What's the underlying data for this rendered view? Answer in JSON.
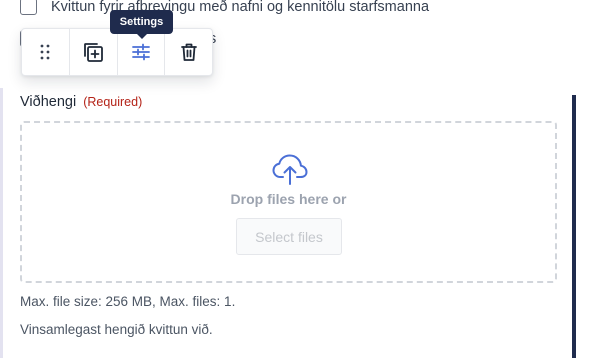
{
  "checkboxes": [
    {
      "label": "Kvittun fyrir afþreyingu með nafni og kennitölu starfsmanna",
      "checked": false
    },
    {
      "label": "s",
      "checked": false
    }
  ],
  "toolbar": {
    "tooltip": "Settings",
    "buttons": [
      {
        "name": "drag-handle",
        "icon": "drag-dots-icon"
      },
      {
        "name": "duplicate",
        "icon": "duplicate-icon"
      },
      {
        "name": "settings",
        "icon": "sliders-icon"
      },
      {
        "name": "delete",
        "icon": "trash-icon"
      }
    ]
  },
  "field": {
    "label": "Viðhengi",
    "required": "(Required)"
  },
  "dropzone": {
    "icon": "cloud-upload-icon",
    "text": "Drop files here or",
    "button_label": "Select files"
  },
  "help": {
    "limits": "Max. file size: 256 MB, Max. files: 1.",
    "description": "Vinsamlegast hengið kvittun við."
  },
  "colors": {
    "accent": "#4a6fd6",
    "tooltip_bg": "#1f2b4d",
    "required": "#b42318"
  }
}
